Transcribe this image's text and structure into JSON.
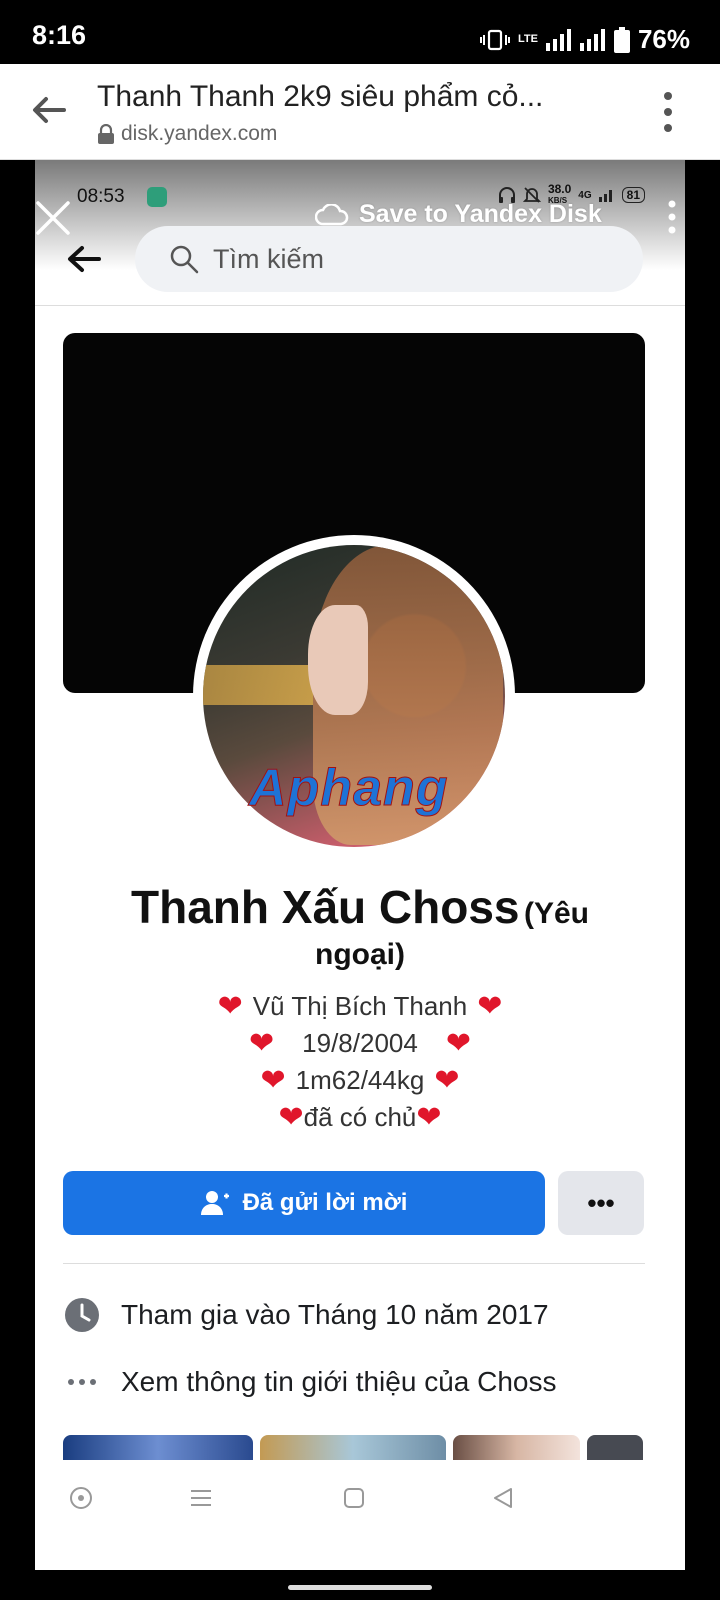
{
  "status_bar": {
    "time": "8:16",
    "network": "LTE",
    "battery": "76%"
  },
  "browser": {
    "title": "Thanh Thanh 2k9 siêu phẩm cỏ...",
    "url": "disk.yandex.com"
  },
  "viewer": {
    "save_label": "Save to Yandex Disk"
  },
  "screenshot": {
    "inner_status": {
      "time": "08:53",
      "speed": "38.0",
      "speed_unit": "KB/S",
      "net": "4G",
      "battery": "81"
    },
    "search": {
      "placeholder": "Tìm kiếm"
    },
    "watermark": "Aphang",
    "profile": {
      "name": "Thanh Xấu Choss",
      "name_suffix_1": "(Yêu",
      "name_suffix_2": "ngoại)",
      "bio": [
        "Vũ Thị Bích Thanh",
        "19/8/2004",
        "1m62/44kg",
        "đã có chủ"
      ]
    },
    "actions": {
      "invite_label": "Đã gửi lời mời",
      "more_label": "•••"
    },
    "info": {
      "joined": "Tham gia vào Tháng 10 năm 2017",
      "about": "Xem thông tin giới thiệu của Choss"
    }
  },
  "colors": {
    "accent": "#1b74e4",
    "heart": "#e0162b"
  },
  "icons": [
    "back-arrow-icon",
    "lock-icon",
    "kebab-menu-icon",
    "close-icon",
    "cloud-icon",
    "search-icon",
    "add-friend-icon",
    "clock-icon",
    "more-dots-icon"
  ]
}
